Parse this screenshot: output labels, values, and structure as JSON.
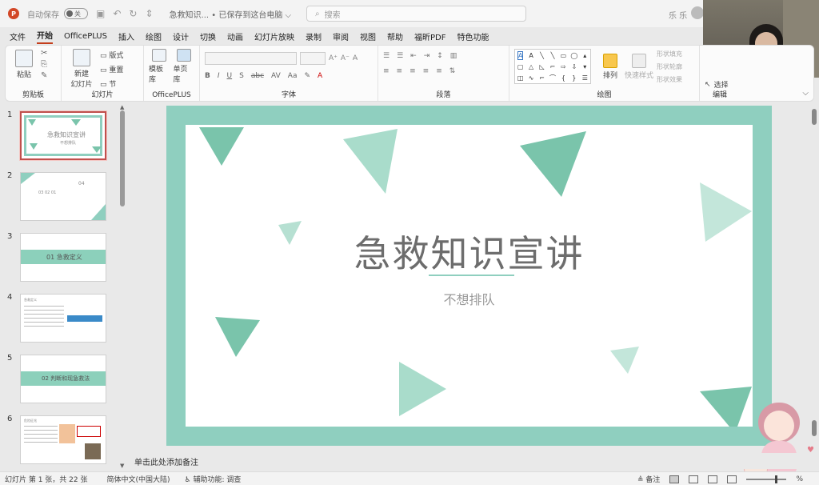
{
  "titlebar": {
    "app_logo": "P",
    "autosave_label": "自动保存",
    "toggle_label": "关",
    "doc_title": "急救知识...  •  已保存到这台电脑 ⌵",
    "search_placeholder": "搜索",
    "user_name": "乐 乐"
  },
  "menu": {
    "tabs": [
      "文件",
      "开始",
      "OfficePLUS",
      "插入",
      "绘图",
      "设计",
      "切换",
      "动画",
      "幻灯片放映",
      "录制",
      "审阅",
      "视图",
      "帮助",
      "福昕PDF",
      "特色功能"
    ],
    "active_tab": "开始"
  },
  "ribbon": {
    "groups": {
      "clipboard": {
        "label": "剪贴板",
        "paste": "粘贴"
      },
      "slides": {
        "label": "幻灯片",
        "new_slide": "新建\n幻灯片",
        "layout": "版式",
        "reset": "重置",
        "section": "节"
      },
      "officeplus": {
        "label": "OfficePLUS",
        "template_lib": "模板库",
        "single_page_lib": "单页库"
      },
      "font": {
        "label": "字体",
        "bold": "B",
        "italic": "I",
        "underline": "U",
        "shadow": "S",
        "strike": "abc"
      },
      "paragraph": {
        "label": "段落"
      },
      "drawing": {
        "label": "绘图",
        "arrange": "排列",
        "quick_styles": "快速样式",
        "fill": "形状填充",
        "outline": "形状轮廓",
        "effects": "形状效果"
      },
      "editing": {
        "label": "编辑",
        "select": "选择"
      }
    }
  },
  "thumbnails": [
    {
      "num": "1",
      "caption": "急救知识宣讲",
      "sub": "不想排队"
    },
    {
      "num": "2",
      "caption": "04",
      "sub": "03  02  01"
    },
    {
      "num": "3",
      "caption": "01 急救定义"
    },
    {
      "num": "4",
      "caption": "急救定义"
    },
    {
      "num": "5",
      "caption": "02 判断和现急救法"
    },
    {
      "num": "6",
      "caption": "危险征兆"
    }
  ],
  "slide": {
    "title": "急救知识宣讲",
    "subtitle": "不想排队",
    "accent": "#8fcfbf",
    "triangle_color": "#7ac4ab"
  },
  "notes": {
    "placeholder": "单击此处添加备注"
  },
  "status": {
    "slide_info": "幻灯片 第 1 张，共 22 张",
    "language": "简体中文(中国大陆)",
    "accessibility": "辅助功能: 调查",
    "notes_btn": "备注",
    "zoom": "%"
  }
}
